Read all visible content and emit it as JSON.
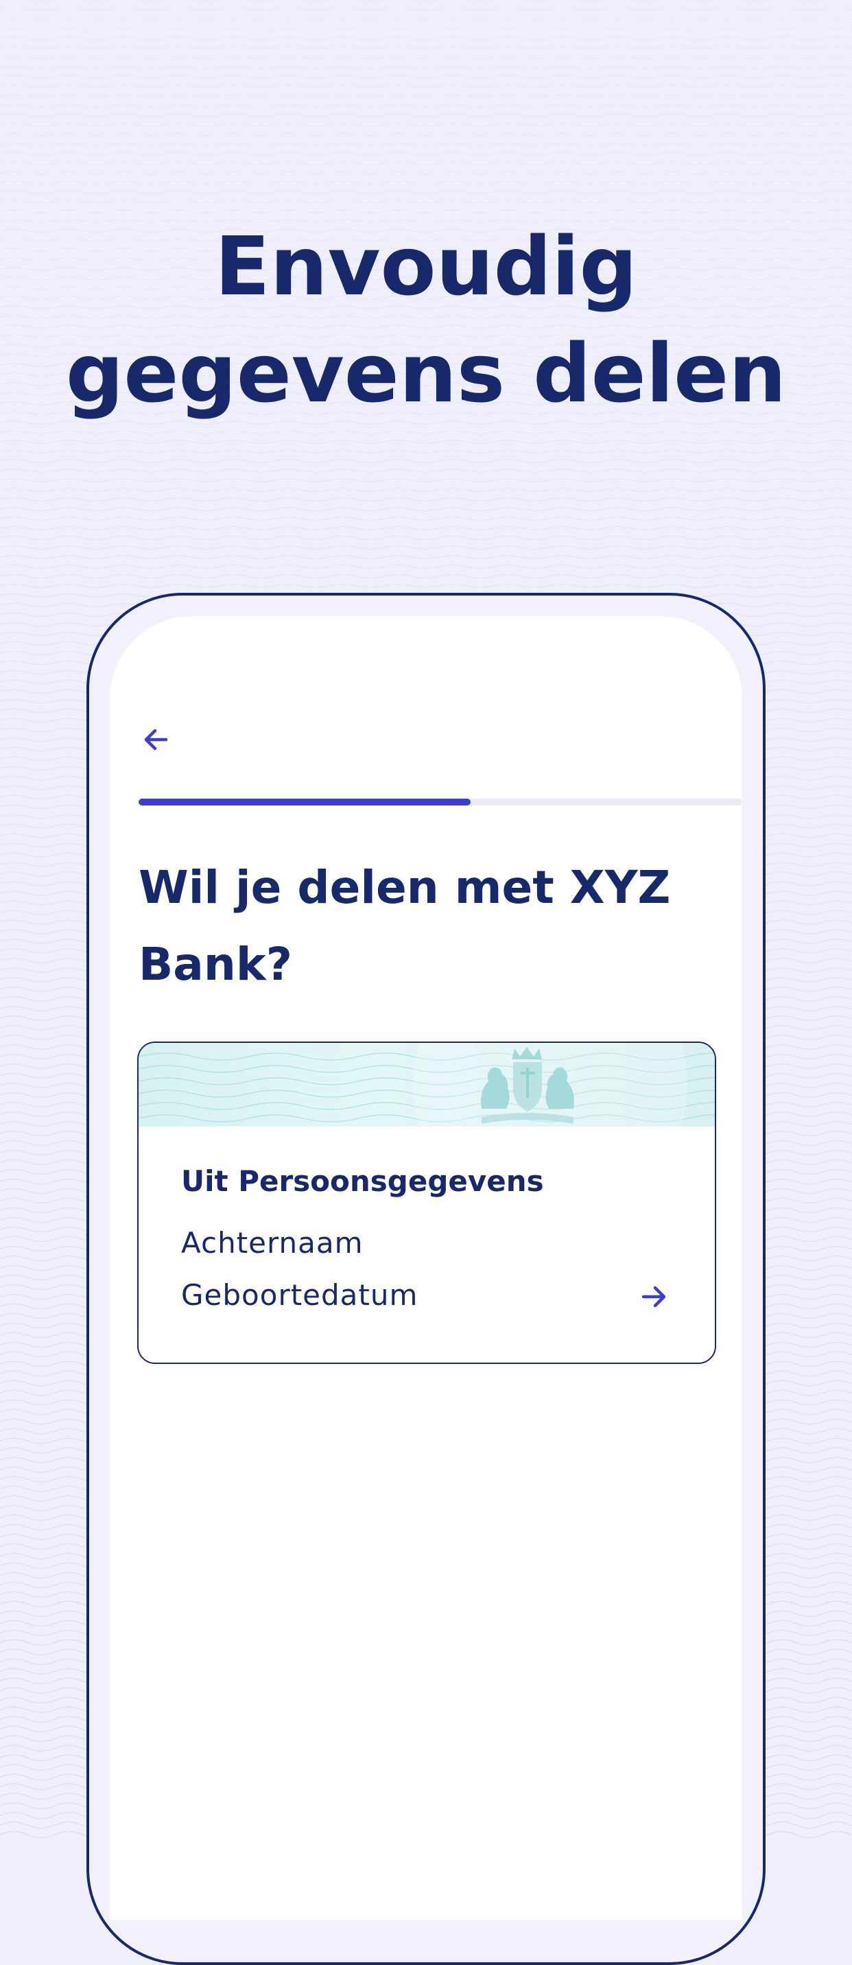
{
  "headline": {
    "line1": "Envoudig",
    "line2": "gegevens delen"
  },
  "screen": {
    "back_icon": "arrow-left-icon",
    "progress": 0.55,
    "question": "Wil je delen met  XYZ Bank?",
    "card": {
      "title": "Uit Persoonsgegevens",
      "items": [
        "Achternaam",
        "Geboortedatum"
      ],
      "arrow_icon": "arrow-right-icon",
      "emblem_icon": "coat-of-arms-icon"
    }
  },
  "colors": {
    "primary_text": "#18296b",
    "accent": "#3b3fd0",
    "background": "#efeffb",
    "card_banner": "#d6f1f2"
  }
}
